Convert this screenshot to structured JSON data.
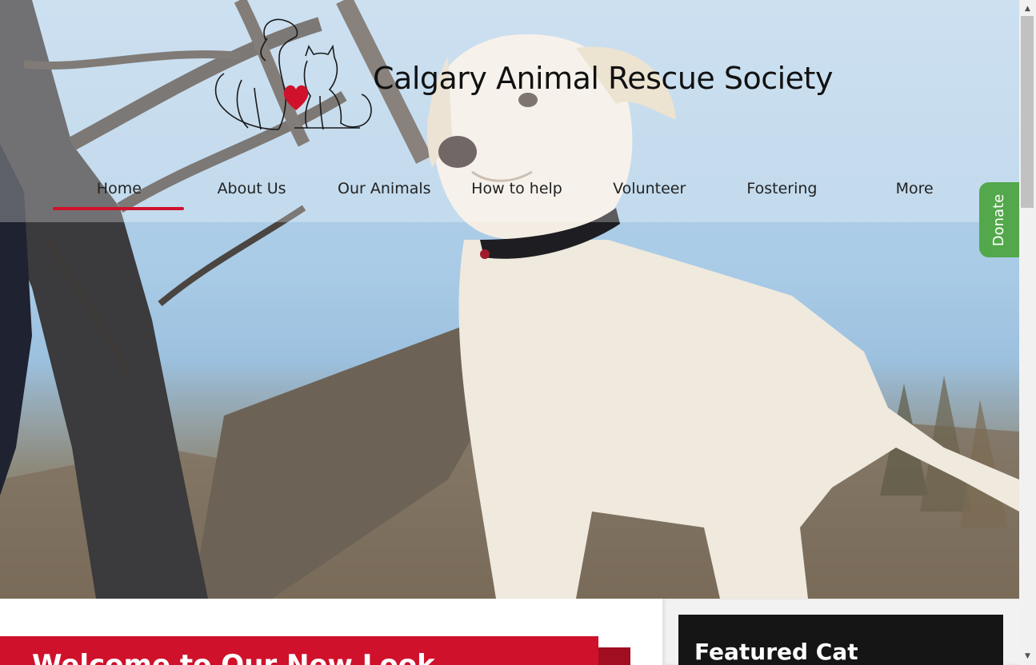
{
  "header": {
    "site_title": "Calgary Animal Rescue Society",
    "logo_icon": "dog-and-cat-heart-logo"
  },
  "nav": {
    "items": [
      {
        "label": "Home",
        "active": true
      },
      {
        "label": "About Us",
        "active": false
      },
      {
        "label": "Our Animals",
        "active": false
      },
      {
        "label": "How to help",
        "active": false
      },
      {
        "label": "Volunteer",
        "active": false
      },
      {
        "label": "Fostering",
        "active": false
      },
      {
        "label": "More",
        "active": false
      }
    ]
  },
  "donate": {
    "label": "Donate"
  },
  "main": {
    "welcome_heading": "Welcome to Our New Look"
  },
  "sidebar": {
    "featured_heading": "Featured Cat"
  },
  "colors": {
    "accent_red": "#d0112b",
    "donate_green": "#52a84a",
    "featured_bg": "#151515"
  },
  "hero": {
    "image": "white-puppy-with-collar-outdoors"
  }
}
